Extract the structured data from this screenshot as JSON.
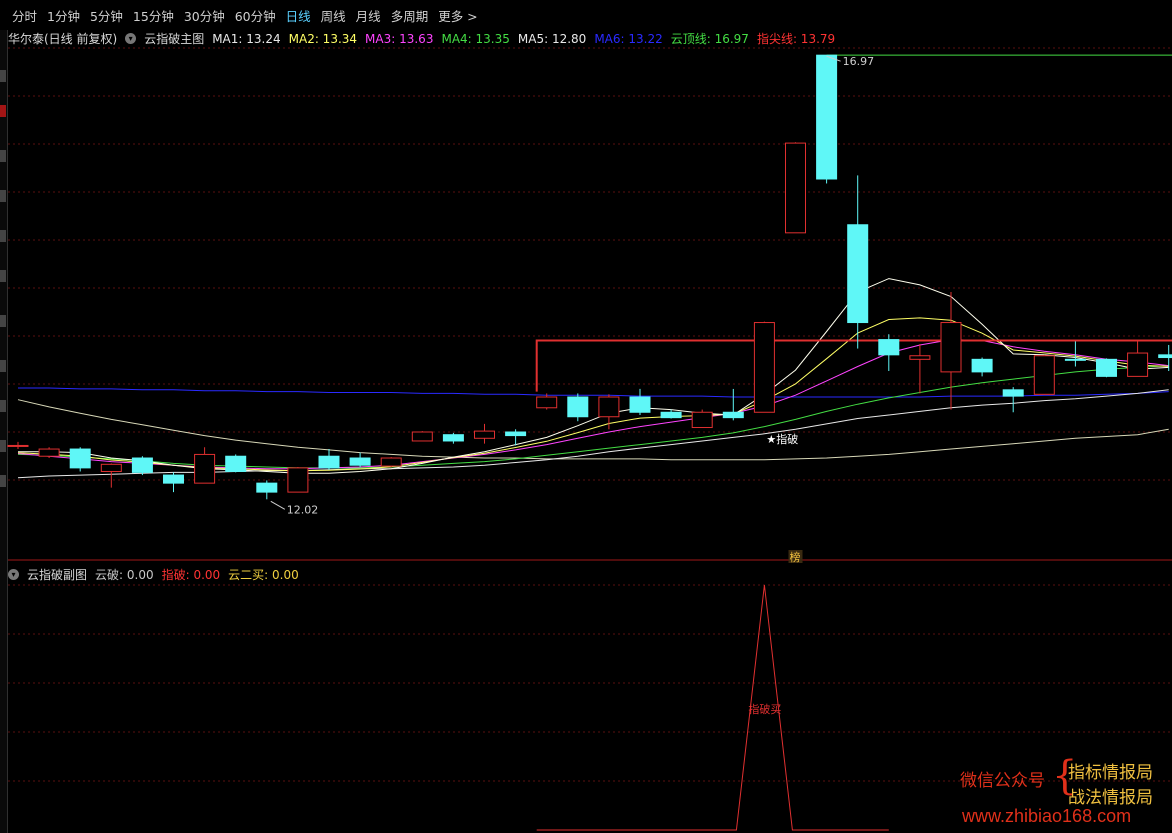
{
  "toolbar": {
    "periods": [
      "分时",
      "1分钟",
      "5分钟",
      "15分钟",
      "30分钟",
      "60分钟",
      "日线",
      "周线",
      "月线",
      "多周期",
      "更多 >"
    ],
    "active_index": 6
  },
  "main": {
    "title": "华尔泰(日线 前复权)",
    "indicator": "云指破主图",
    "params": [
      {
        "label": "MA1: 13.24",
        "color": "#e8e8e8"
      },
      {
        "label": "MA2: 13.34",
        "color": "#ffff66"
      },
      {
        "label": "MA3: 13.63",
        "color": "#ff44ff"
      },
      {
        "label": "MA4: 13.35",
        "color": "#44dd44"
      },
      {
        "label": "MA5: 12.80",
        "color": "#e8e8e8"
      },
      {
        "label": "MA6: 13.22",
        "color": "#2a2aff"
      },
      {
        "label": "云顶线: 16.97",
        "color": "#44dd44"
      },
      {
        "label": "指尖线: 13.79",
        "color": "#ff3333"
      }
    ],
    "high_label": "16.97",
    "low_label": "12.02",
    "signal_label": "★指破",
    "bang_badge": "榜"
  },
  "sub": {
    "indicator": "云指破副图",
    "params": [
      {
        "label": "云破: 0.00",
        "color": "#c8c8c8"
      },
      {
        "label": "指破: 0.00",
        "color": "#ff3333"
      },
      {
        "label": "云二买: 0.00",
        "color": "#f0d040"
      }
    ],
    "spike_label": "指破买"
  },
  "colors": {
    "up": "#e03030",
    "down": "#5ff7f7",
    "accent": "#5ad1ff"
  },
  "watermark": {
    "line1": "微信公众号",
    "brace": "{",
    "line2": "指标情报局",
    "line3": "战法情报局",
    "url": "www.zhibiao168.com"
  },
  "chart_data": {
    "type": "candlestick",
    "candles": [
      {
        "o": 12.62,
        "c": 12.62,
        "h": 12.66,
        "l": 12.58
      },
      {
        "o": 12.5,
        "c": 12.58,
        "h": 12.6,
        "l": 12.48
      },
      {
        "o": 12.58,
        "c": 12.37,
        "h": 12.6,
        "l": 12.33
      },
      {
        "o": 12.33,
        "c": 12.41,
        "h": 12.42,
        "l": 12.15
      },
      {
        "o": 12.48,
        "c": 12.32,
        "h": 12.5,
        "l": 12.29
      },
      {
        "o": 12.29,
        "c": 12.2,
        "h": 12.32,
        "l": 12.1
      },
      {
        "o": 12.2,
        "c": 12.52,
        "h": 12.6,
        "l": 12.2
      },
      {
        "o": 12.5,
        "c": 12.33,
        "h": 12.52,
        "l": 12.32
      },
      {
        "o": 12.2,
        "c": 12.1,
        "h": 12.23,
        "l": 12.02
      },
      {
        "o": 12.1,
        "c": 12.37,
        "h": 12.38,
        "l": 12.1
      },
      {
        "o": 12.5,
        "c": 12.37,
        "h": 12.58,
        "l": 12.35
      },
      {
        "o": 12.48,
        "c": 12.4,
        "h": 12.54,
        "l": 12.38
      },
      {
        "o": 12.39,
        "c": 12.48,
        "h": 12.49,
        "l": 12.38
      },
      {
        "o": 12.67,
        "c": 12.77,
        "h": 12.78,
        "l": 12.67
      },
      {
        "o": 12.74,
        "c": 12.67,
        "h": 12.76,
        "l": 12.64
      },
      {
        "o": 12.7,
        "c": 12.78,
        "h": 12.86,
        "l": 12.64
      },
      {
        "o": 12.77,
        "c": 12.73,
        "h": 12.8,
        "l": 12.62
      },
      {
        "o": 13.04,
        "c": 13.16,
        "h": 13.2,
        "l": 13.02
      },
      {
        "o": 13.16,
        "c": 12.94,
        "h": 13.2,
        "l": 12.89
      },
      {
        "o": 12.94,
        "c": 13.16,
        "h": 13.19,
        "l": 12.8
      },
      {
        "o": 13.16,
        "c": 12.99,
        "h": 13.25,
        "l": 12.96
      },
      {
        "o": 12.99,
        "c": 12.93,
        "h": 13.02,
        "l": 12.92
      },
      {
        "o": 12.82,
        "c": 12.99,
        "h": 13.02,
        "l": 12.82
      },
      {
        "o": 12.99,
        "c": 12.93,
        "h": 13.25,
        "l": 12.9
      },
      {
        "o": 12.99,
        "c": 13.99,
        "h": 14.0,
        "l": 12.99
      },
      {
        "o": 14.99,
        "c": 15.99,
        "h": 16.0,
        "l": 14.99
      },
      {
        "o": 16.97,
        "c": 15.59,
        "h": 16.97,
        "l": 15.54
      },
      {
        "o": 15.08,
        "c": 13.99,
        "h": 15.63,
        "l": 13.7
      },
      {
        "o": 13.8,
        "c": 13.63,
        "h": 13.86,
        "l": 13.45
      },
      {
        "o": 13.58,
        "c": 13.62,
        "h": 13.75,
        "l": 13.2
      },
      {
        "o": 13.44,
        "c": 13.99,
        "h": 14.33,
        "l": 13.02
      },
      {
        "o": 13.58,
        "c": 13.44,
        "h": 13.6,
        "l": 13.39
      },
      {
        "o": 13.24,
        "c": 13.17,
        "h": 13.27,
        "l": 12.99
      },
      {
        "o": 13.19,
        "c": 13.62,
        "h": 13.63,
        "l": 13.19
      },
      {
        "o": 13.58,
        "c": 13.57,
        "h": 13.78,
        "l": 13.5
      },
      {
        "o": 13.58,
        "c": 13.39,
        "h": 13.59,
        "l": 13.38
      },
      {
        "o": 13.39,
        "c": 13.65,
        "h": 13.78,
        "l": 13.39
      },
      {
        "o": 13.63,
        "c": 13.6,
        "h": 13.74,
        "l": 13.45
      }
    ],
    "ma_short": [
      12.55,
      12.55,
      12.54,
      12.48,
      12.45,
      12.4,
      12.36,
      12.35,
      12.33,
      12.31,
      12.31,
      12.33,
      12.36,
      12.42,
      12.49,
      12.55,
      12.63,
      12.71,
      12.84,
      12.98,
      13.04,
      13.02,
      12.98,
      12.96,
      13.19,
      13.46,
      13.89,
      14.33,
      14.48,
      14.41,
      14.28,
      13.97,
      13.64,
      13.63,
      13.6,
      13.54,
      13.47,
      13.49
    ],
    "ma_mid": [
      12.53,
      12.5,
      12.47,
      12.44,
      12.42,
      12.4,
      12.38,
      12.37,
      12.36,
      12.36,
      12.37,
      12.38,
      12.4,
      12.44,
      12.48,
      12.52,
      12.57,
      12.63,
      12.7,
      12.77,
      12.83,
      12.88,
      12.93,
      12.98,
      13.06,
      13.18,
      13.34,
      13.5,
      13.65,
      13.74,
      13.8,
      13.79,
      13.72,
      13.67,
      13.63,
      13.58,
      13.55,
      13.51
    ],
    "ma_long": [
      12.52,
      12.51,
      12.49,
      12.47,
      12.45,
      12.42,
      12.4,
      12.39,
      12.38,
      12.37,
      12.37,
      12.37,
      12.38,
      12.4,
      12.42,
      12.44,
      12.47,
      12.51,
      12.55,
      12.59,
      12.63,
      12.67,
      12.71,
      12.76,
      12.83,
      12.91,
      13.0,
      13.08,
      13.15,
      13.21,
      13.27,
      13.32,
      13.36,
      13.4,
      13.44,
      13.47,
      13.49,
      13.51
    ],
    "ma_base": [
      12.26,
      12.28,
      12.29,
      12.3,
      12.31,
      12.32,
      12.32,
      12.33,
      12.34,
      12.34,
      12.35,
      12.36,
      12.36,
      12.37,
      12.38,
      12.4,
      12.43,
      12.46,
      12.5,
      12.55,
      12.59,
      12.63,
      12.67,
      12.71,
      12.75,
      12.8,
      12.86,
      12.92,
      12.96,
      13.0,
      13.04,
      13.07,
      13.09,
      13.12,
      13.14,
      13.17,
      13.2,
      13.24
    ],
    "ma_slow": [
      13.13,
      13.05,
      12.98,
      12.91,
      12.85,
      12.79,
      12.73,
      12.68,
      12.64,
      12.6,
      12.57,
      12.54,
      12.52,
      12.5,
      12.49,
      12.48,
      12.48,
      12.47,
      12.47,
      12.47,
      12.47,
      12.46,
      12.46,
      12.46,
      12.46,
      12.47,
      12.48,
      12.5,
      12.52,
      12.55,
      12.58,
      12.61,
      12.64,
      12.67,
      12.7,
      12.72,
      12.74,
      12.8
    ],
    "ma_blue": [
      13.26,
      13.26,
      13.25,
      13.25,
      13.24,
      13.24,
      13.23,
      13.23,
      13.22,
      13.22,
      13.21,
      13.21,
      13.21,
      13.2,
      13.2,
      13.19,
      13.19,
      13.18,
      13.18,
      13.18,
      13.17,
      13.17,
      13.17,
      13.16,
      13.16,
      13.16,
      13.16,
      13.16,
      13.16,
      13.16,
      13.17,
      13.17,
      13.17,
      13.18,
      13.18,
      13.19,
      13.2,
      13.22
    ],
    "ceiling_line": {
      "from": 26,
      "to": 37,
      "value": 16.97
    },
    "fingertip_line": {
      "from": 17,
      "to": 37,
      "value": 13.79
    },
    "sub_spike": {
      "index": 24,
      "value": 1.0
    },
    "price_range": [
      11.7,
      17.05
    ]
  }
}
